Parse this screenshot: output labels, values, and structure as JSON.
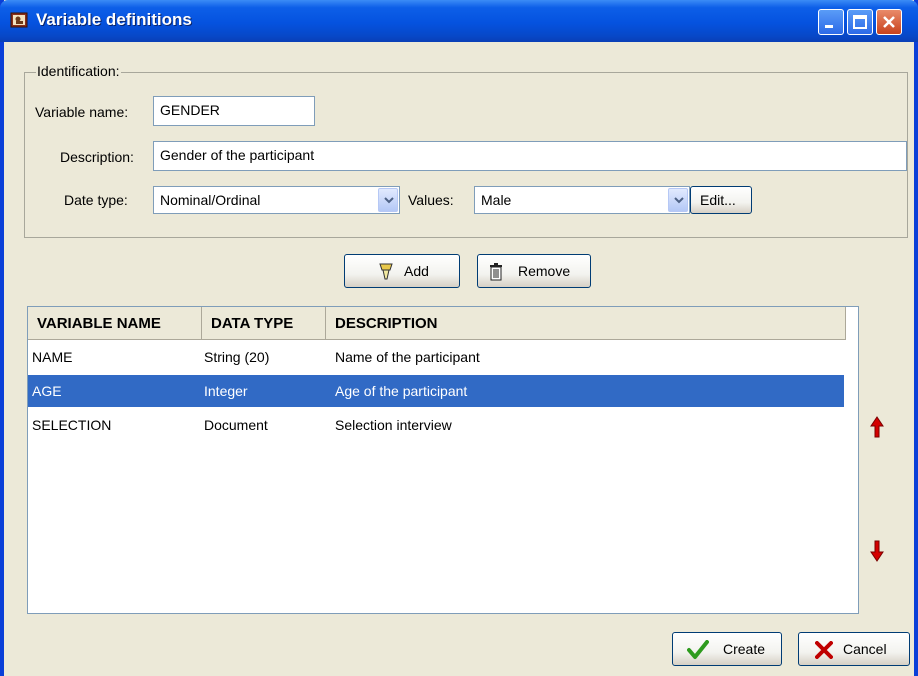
{
  "window": {
    "title": "Variable definitions"
  },
  "identification": {
    "legend": "Identification:",
    "variable_name_label": "Variable name:",
    "variable_name_value": "GENDER",
    "description_label": "Description:",
    "description_value": "Gender of the participant",
    "date_type_label": "Date type:",
    "date_type_value": "Nominal/Ordinal",
    "values_label": "Values:",
    "values_value": "Male",
    "edit_label": "Edit..."
  },
  "actions": {
    "add_label": "Add",
    "remove_label": "Remove"
  },
  "table": {
    "columns": [
      "VARIABLE NAME",
      "DATA TYPE",
      "DESCRIPTION"
    ],
    "rows": [
      {
        "name": "NAME",
        "type": "String (20)",
        "description": "Name of the participant",
        "selected": false
      },
      {
        "name": "AGE",
        "type": "Integer",
        "description": "Age of the participant",
        "selected": true
      },
      {
        "name": "SELECTION",
        "type": "Document",
        "description": "Selection interview",
        "selected": false
      }
    ]
  },
  "footer": {
    "create_label": "Create",
    "cancel_label": "Cancel"
  },
  "icons": {
    "app": "app-icon",
    "add": "pen-icon",
    "remove": "trash-icon",
    "create": "checkmark-icon",
    "cancel": "x-icon",
    "move_up": "arrow-up-icon",
    "move_down": "arrow-down-icon"
  },
  "colors": {
    "title_bar": "#0552df",
    "selection": "#316ac5",
    "arrow": "#d40000",
    "check": "#2e9b1e"
  }
}
